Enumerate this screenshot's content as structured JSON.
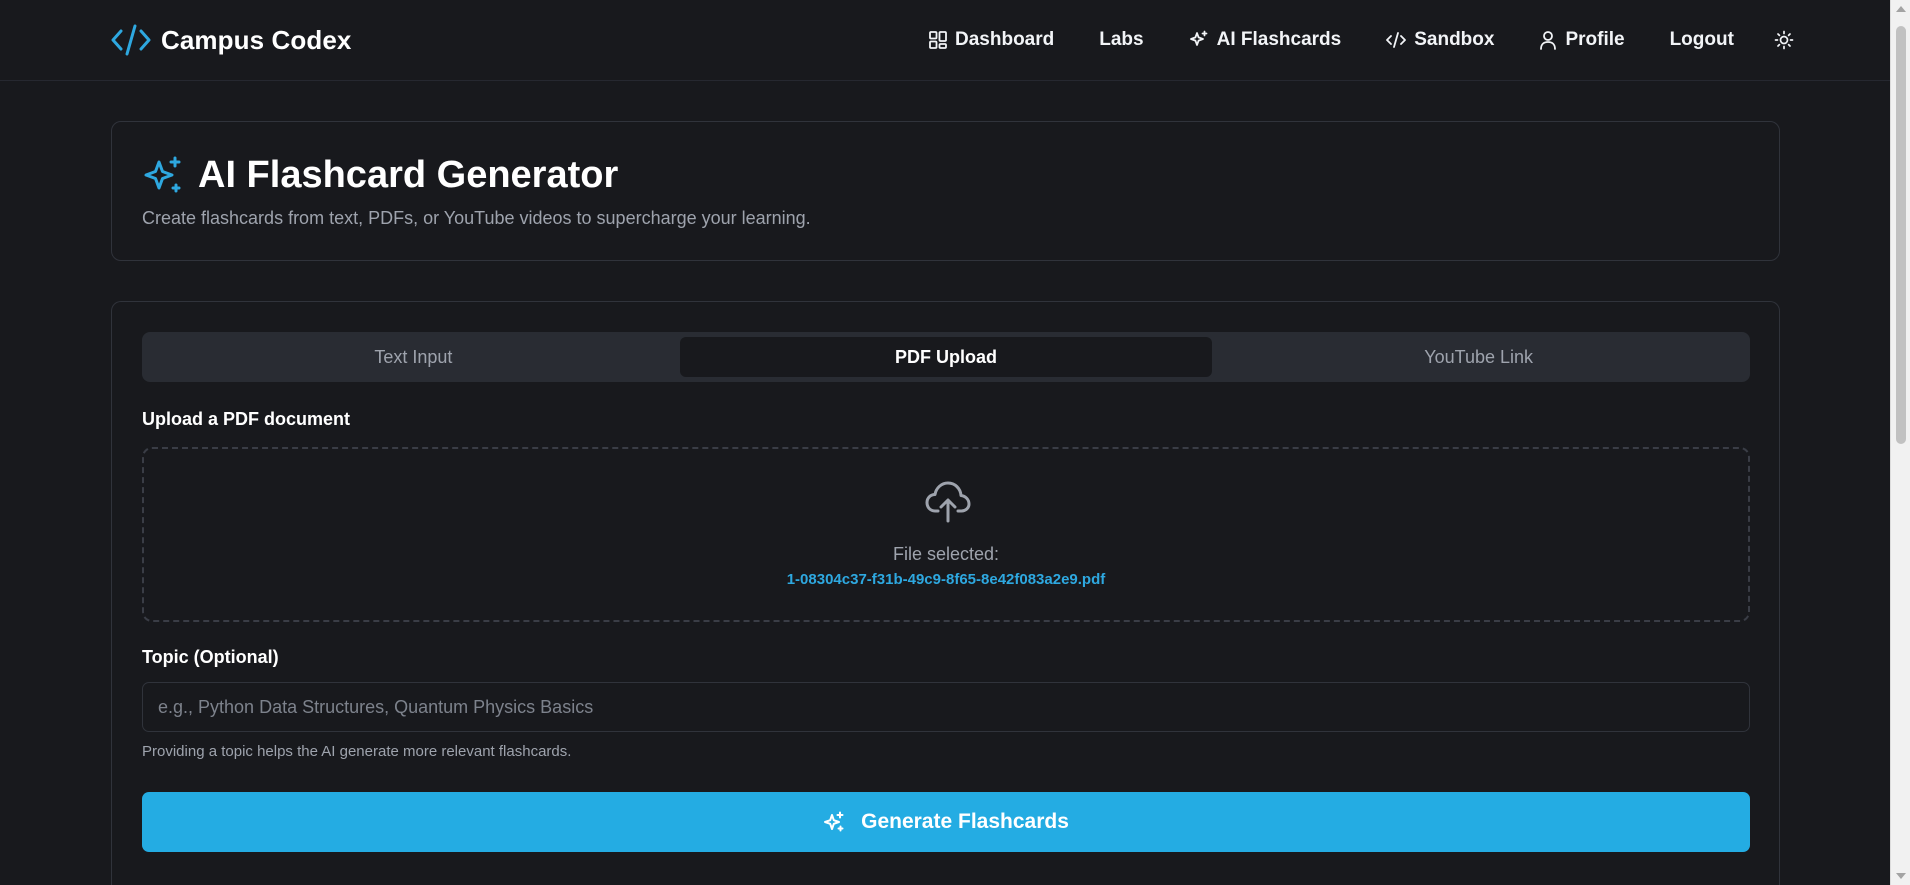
{
  "brand": {
    "name": "Campus Codex",
    "icon": "code-brackets-icon",
    "accent": "#2ea8e0"
  },
  "nav": {
    "items": [
      {
        "label": "Dashboard",
        "icon": "grid-icon"
      },
      {
        "label": "Labs",
        "icon": ""
      },
      {
        "label": "AI Flashcards",
        "icon": "sparkles-icon"
      },
      {
        "label": "Sandbox",
        "icon": "code-icon"
      },
      {
        "label": "Profile",
        "icon": "user-icon"
      },
      {
        "label": "Logout",
        "icon": ""
      }
    ],
    "theme_toggle_icon": "sun-icon"
  },
  "hero": {
    "title": "AI Flashcard Generator",
    "subtitle": "Create flashcards from text, PDFs, or YouTube videos to supercharge your learning.",
    "icon": "sparkles-icon"
  },
  "tabs": [
    {
      "label": "Text Input",
      "active": false
    },
    {
      "label": "PDF Upload",
      "active": true
    },
    {
      "label": "YouTube Link",
      "active": false
    }
  ],
  "upload": {
    "label": "Upload a PDF document",
    "icon": "cloud-upload-icon",
    "status": "File selected:",
    "file_name": "1-08304c37-f31b-49c9-8f65-8e42f083a2e9.pdf"
  },
  "topic": {
    "label": "Topic (Optional)",
    "value": "",
    "placeholder": "e.g., Python Data Structures, Quantum Physics Basics",
    "helper": "Providing a topic helps the AI generate more relevant flashcards."
  },
  "generate": {
    "label": "Generate Flashcards",
    "icon": "sparkles-icon",
    "color": "#24ace3"
  },
  "colors": {
    "background": "#18191d",
    "card_border": "#30333b",
    "tab_bar": "#292c33",
    "muted_text": "#9ea3ad"
  }
}
